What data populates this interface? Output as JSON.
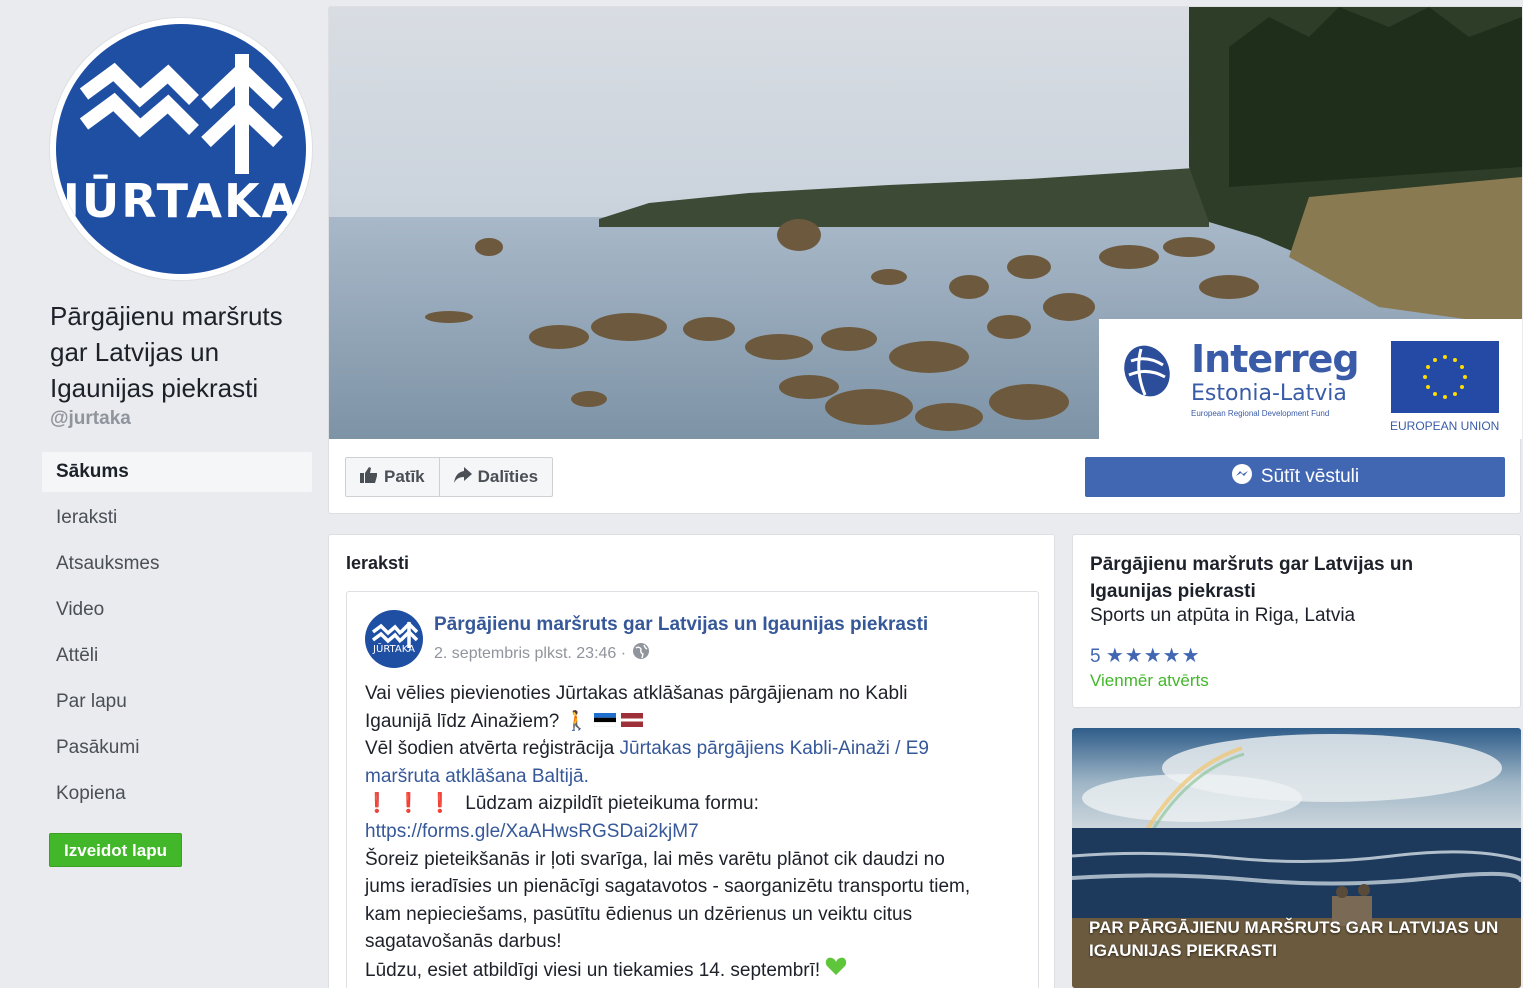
{
  "page": {
    "logo_text": "JŪRTAKA",
    "name": "Pārgājienu maršruts gar Latvijas un Igaunijas piekrasti",
    "name_lines": [
      "Pārgājienu maršruts",
      "gar Latvijas un",
      "Igaunijas piekrasti"
    ],
    "handle": "@jurtaka"
  },
  "nav": {
    "items": [
      {
        "label": "Sākums",
        "active": true
      },
      {
        "label": "Ieraksti"
      },
      {
        "label": "Atsauksmes"
      },
      {
        "label": "Video"
      },
      {
        "label": "Attēli"
      },
      {
        "label": "Par lapu"
      },
      {
        "label": "Pasākumi"
      },
      {
        "label": "Kopiena"
      }
    ],
    "create_page_label": "Izveidot lapu"
  },
  "cover": {
    "interreg_title": "Interreg",
    "interreg_subtitle": "Estonia-Latvia",
    "interreg_fund": "European Regional Development Fund",
    "eu_label": "EUROPEAN UNION"
  },
  "actions": {
    "like_label": "Patīk",
    "share_label": "Dalīties",
    "message_label": "Sūtīt vēstuli"
  },
  "posts": {
    "heading": "Ieraksti",
    "post": {
      "avatar_text": "JŪRTAKA",
      "author": "Pārgājienu maršruts gar Latvijas un Igaunijas piekrasti",
      "time": "2. septembris plkst. 23:46 ·",
      "line1": "Vai vēlies pievienoties Jūrtakas atklāšanas pārgājienam no Kabli",
      "line2": "Igaunijā līdz Ainažiem?",
      "line3_prefix": "Vēl šodien atvērta reģistrācija",
      "line3_link": "Jūrtakas pārgājiens Kabli-Ainaži / E9",
      "line4_link": "maršruta atklāšana Baltijā",
      "line4_suffix": ".",
      "exclamations": "❗❗❗",
      "line5": "Lūdzam aizpildīt pieteikuma formu:",
      "form_link": "https://forms.gle/XaAHwsRGSDai2kjM7",
      "line7": "Šoreiz pieteikšanās ir ļoti svarīga, lai mēs varētu plānot cik daudzi no",
      "line8": "jums ieradīsies un pienācīgi sagatavotos - saorganizētu transportu tiem,",
      "line9": "kam nepieciešams, pasūtītu ēdienus un dzērienus un veiktu citus",
      "line10": "sagatavošanās darbus!",
      "line11": "Lūdzu, esiet atbildīgi viesi un tiekamies 14. septembrī!"
    }
  },
  "about": {
    "name": "Pārgājienu maršruts gar Latvijas un Igaunijas piekrasti",
    "category": "Sports un atpūta in Riga, Latvia",
    "rating": "5",
    "stars": "★★★★★",
    "open_status": "Vienmēr atvērts"
  },
  "photo": {
    "caption": "PAR PĀRGĀJIENU MARŠRUTS GAR LATVIJAS UN IGAUNIJAS PIEKRASTI"
  },
  "colors": {
    "brand_blue": "#4267b2",
    "link_blue": "#365899",
    "green": "#42b72a",
    "logo_blue": "#1f4fa3"
  }
}
